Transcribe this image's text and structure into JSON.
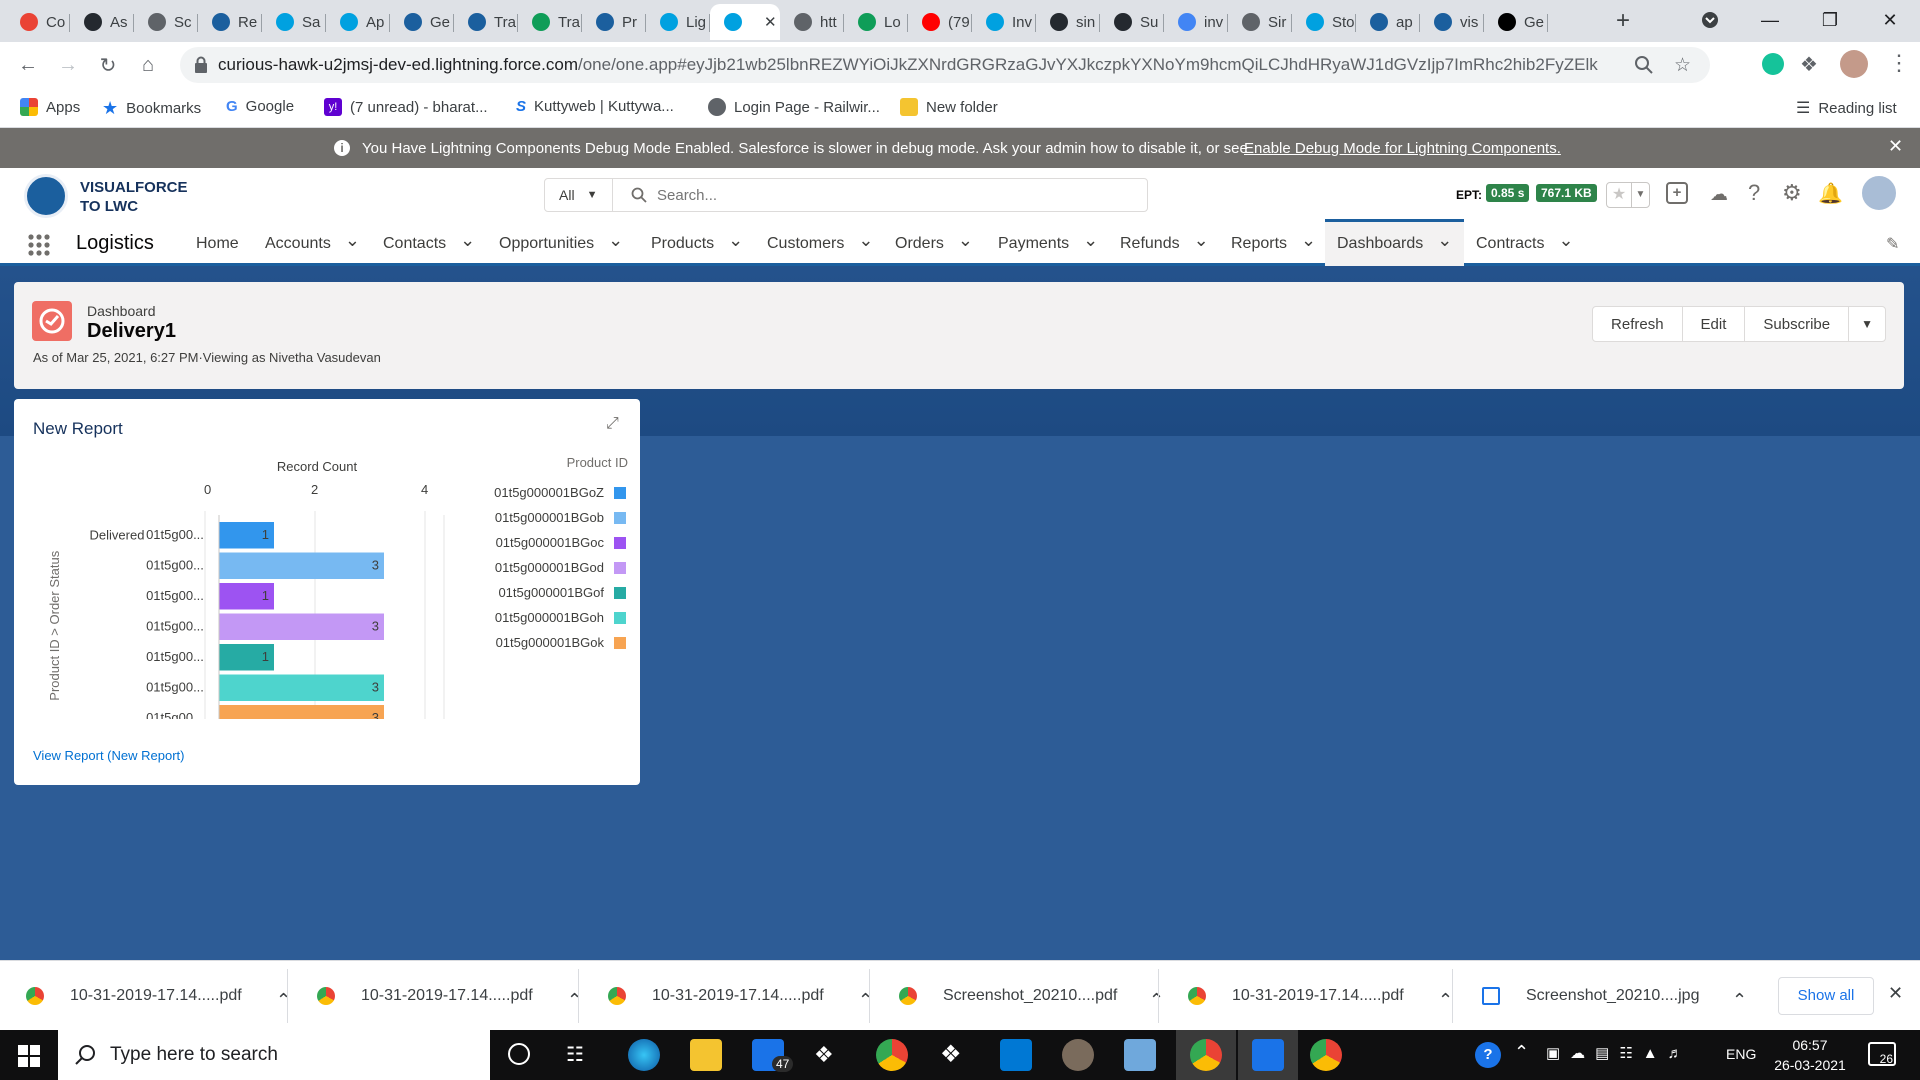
{
  "browser": {
    "tabs": [
      {
        "label": "Co",
        "icon": "gmail-icon",
        "color": "#ea4335"
      },
      {
        "label": "As",
        "icon": "github-icon",
        "color": "#24292f"
      },
      {
        "label": "Sc",
        "icon": "play-icon",
        "color": "#5f6368"
      },
      {
        "label": "Re",
        "icon": "trailhead-icon",
        "color": "#1b5f9e"
      },
      {
        "label": "Sa",
        "icon": "salesforce-icon",
        "color": "#00a1e0"
      },
      {
        "label": "Ap",
        "icon": "salesforce-icon",
        "color": "#00a1e0"
      },
      {
        "label": "Ge",
        "icon": "trailhead-icon",
        "color": "#1b5f9e"
      },
      {
        "label": "Tra",
        "icon": "trailhead-icon",
        "color": "#1b5f9e"
      },
      {
        "label": "Tra",
        "icon": "sheets-icon",
        "color": "#0f9d58"
      },
      {
        "label": "Pr",
        "icon": "trailhead-icon",
        "color": "#1b5f9e"
      },
      {
        "label": "Lig",
        "icon": "salesforce-icon",
        "color": "#00a1e0"
      },
      {
        "label": "",
        "icon": "salesforce-icon",
        "color": "#00a1e0",
        "active": true
      },
      {
        "label": "htt",
        "icon": "globe-icon",
        "color": "#5f6368"
      },
      {
        "label": "Lo",
        "icon": "sheets-icon",
        "color": "#0f9d58"
      },
      {
        "label": "(79",
        "icon": "youtube-icon",
        "color": "#ff0000"
      },
      {
        "label": "Inv",
        "icon": "salesforce-icon",
        "color": "#00a1e0"
      },
      {
        "label": "sin",
        "icon": "github-icon",
        "color": "#24292f"
      },
      {
        "label": "Su",
        "icon": "github-icon",
        "color": "#24292f"
      },
      {
        "label": "inv",
        "icon": "google-icon",
        "color": "#4285f4"
      },
      {
        "label": "Sir",
        "icon": "globe-icon",
        "color": "#5f6368"
      },
      {
        "label": "Sto",
        "icon": "salesforce-icon",
        "color": "#00a1e0"
      },
      {
        "label": "ap",
        "icon": "cloud-icon",
        "color": "#1b5f9e"
      },
      {
        "label": "vis",
        "icon": "cloud-icon",
        "color": "#1b5f9e"
      },
      {
        "label": "Ge",
        "icon": "notion-icon",
        "color": "#000000"
      }
    ],
    "url_host": "curious-hawk-u2jmsj-dev-ed.lightning.force.com",
    "url_path": "/one/one.app#eyJjb21wb25lbnREZWYiOiJkZXNrdG9wRGFzaGJvYXJkcy...",
    "url_display_rest": "/one/one.app#eyJjb21wb25lbnREZWYiOiJkZXNrdGRGRzaGJvYXJkczpkYXNoYm9hcmQiLCJhdHRyaWJ1dGVzIjp7ImRhc2hib2FyZElkIjoi..."
  },
  "bookmarks": {
    "items": [
      "Apps",
      "Bookmarks",
      "Google",
      "(7 unread) - bharat...",
      "Kuttyweb | Kuttywa...",
      "Login Page - Railwir...",
      "New folder"
    ],
    "reading_list": "Reading list"
  },
  "debug_banner": {
    "text": "You Have Lightning Components Debug Mode Enabled. Salesforce is slower in debug mode. Ask your admin how to disable it, or see",
    "link": "Enable Debug Mode for Lightning Components."
  },
  "sf": {
    "logo_line1": "VISUALFORCE",
    "logo_line2": "TO LWC",
    "search_scope": "All",
    "search_placeholder": "Search...",
    "ept_label": "EPT:",
    "ept_time": "0.85 s",
    "ept_size": "767.1 KB",
    "app_name": "Logistics",
    "nav": [
      "Home",
      "Accounts",
      "Contacts",
      "Opportunities",
      "Products",
      "Customers",
      "Orders",
      "Payments",
      "Refunds",
      "Reports",
      "Dashboards",
      "Contracts"
    ],
    "active_nav": "Dashboards"
  },
  "dashboard": {
    "type_label": "Dashboard",
    "title": "Delivery1",
    "as_of": "As of Mar 25, 2021, 6:27 PM·Viewing as Nivetha Vasudevan",
    "buttons": [
      "Refresh",
      "Edit",
      "Subscribe"
    ]
  },
  "widget": {
    "title": "New Report",
    "footer_link": "View Report (New Report)"
  },
  "chart_data": {
    "type": "bar",
    "orientation": "horizontal",
    "title": "",
    "xlabel": "Record Count",
    "ylabel": "Product ID > Order Status",
    "xlim": [
      0,
      4
    ],
    "x_ticks": [
      "0",
      "2",
      "4"
    ],
    "group_label": "Delivered",
    "categories": [
      "01t5g00...",
      "01t5g00...",
      "01t5g00...",
      "01t5g00...",
      "01t5g00...",
      "01t5g00...",
      "01t5g00..."
    ],
    "values": [
      1,
      3,
      1,
      3,
      1,
      3,
      3
    ],
    "colors": [
      "#3296ed",
      "#77b9f2",
      "#9d53f2",
      "#c398f5",
      "#26aba4",
      "#4ed4cd",
      "#f7a452"
    ],
    "legend_title": "Product ID",
    "legend": [
      "01t5g000001BGoZ",
      "01t5g000001BGob",
      "01t5g000001BGoc",
      "01t5g000001BGod",
      "01t5g000001BGof",
      "01t5g000001BGoh",
      "01t5g000001BGok"
    ],
    "legend_position": "right"
  },
  "downloads": {
    "items": [
      {
        "name": "10-31-2019-17.14.....pdf",
        "icon": "chrome-icon"
      },
      {
        "name": "10-31-2019-17.14.....pdf",
        "icon": "chrome-icon"
      },
      {
        "name": "10-31-2019-17.14.....pdf",
        "icon": "chrome-icon"
      },
      {
        "name": "Screenshot_20210....pdf",
        "icon": "chrome-icon"
      },
      {
        "name": "10-31-2019-17.14.....pdf",
        "icon": "chrome-icon"
      },
      {
        "name": "Screenshot_20210....jpg",
        "icon": "file-icon"
      }
    ],
    "show_all": "Show all"
  },
  "taskbar": {
    "search_placeholder": "Type here to search",
    "mail_badge": "47",
    "lang": "ENG",
    "time": "06:57",
    "date": "26-03-2021",
    "notif_count": "26"
  }
}
